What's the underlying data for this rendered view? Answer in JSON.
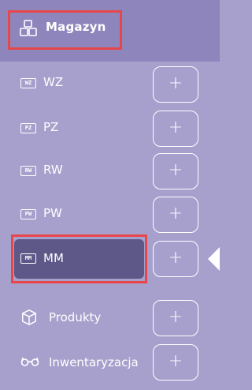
{
  "header": {
    "title": "Magazyn",
    "icon": "boxes-icon"
  },
  "documents": [
    {
      "code": "WZ",
      "label": "WZ",
      "action": "+"
    },
    {
      "code": "PZ",
      "label": "PZ",
      "action": "+"
    },
    {
      "code": "RW",
      "label": "RW",
      "action": "+"
    },
    {
      "code": "PW",
      "label": "PW",
      "action": "+"
    },
    {
      "code": "MM",
      "label": "MM",
      "action": "+",
      "active": true
    }
  ],
  "sections": [
    {
      "label": "Produkty",
      "icon": "box-icon",
      "action": "+"
    },
    {
      "label": "Inwentaryzacja",
      "icon": "glasses-icon",
      "action": "+"
    }
  ],
  "colors": {
    "header_bg": "#8f85bd",
    "sidebar_bg": "#a7a0cc",
    "active_bg": "#5e5888",
    "highlight": "#e8474a"
  }
}
